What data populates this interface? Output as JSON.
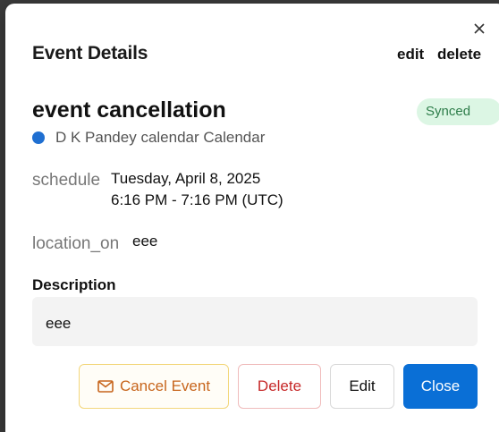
{
  "dialog": {
    "title": "Event Details",
    "close_icon": "close-icon",
    "header_actions": {
      "edit": "edit",
      "delete": "delete"
    }
  },
  "event": {
    "title": "event cancellation",
    "sync_status": "Synced",
    "calendar_name": "D K Pandey calendar Calendar",
    "calendar_color": "#1f6fd1",
    "schedule_label": "schedule",
    "date": "Tuesday, April 8, 2025",
    "time": "6:16 PM - 7:16 PM (UTC)",
    "location_label": "location_on",
    "location": "eee",
    "description_heading": "Description",
    "description": "eee"
  },
  "buttons": {
    "cancel_event": "Cancel Event",
    "cancel_event_icon": "mail-icon",
    "delete": "Delete",
    "edit": "Edit",
    "close": "Close"
  },
  "colors": {
    "primary": "#0a6fd6",
    "danger": "#c62828",
    "warning": "#c7651c",
    "synced_bg": "#dcf6e4",
    "synced_text": "#2e7d4a"
  }
}
